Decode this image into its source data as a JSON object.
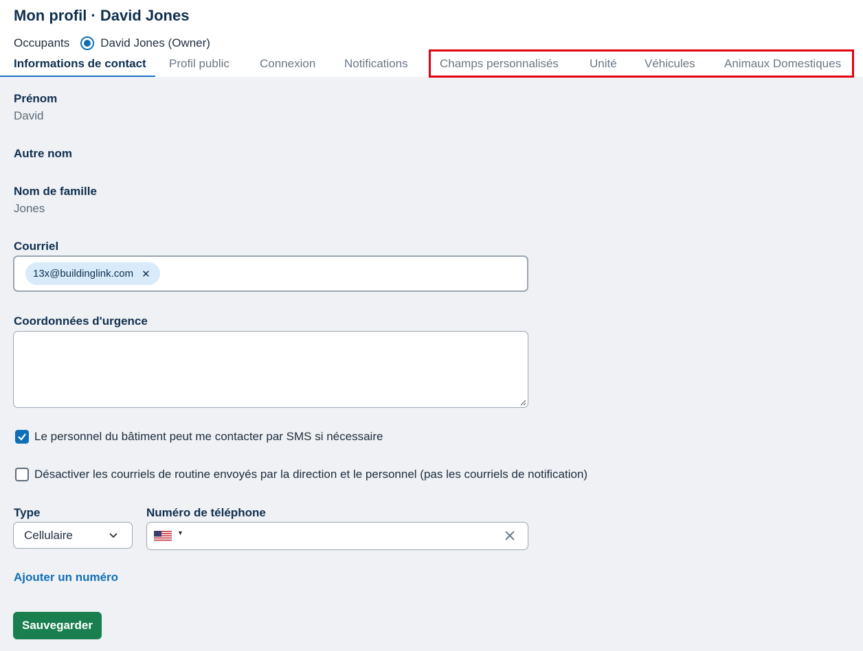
{
  "header": {
    "title": "Mon profil · David Jones",
    "occupants_label": "Occupants",
    "occupant_selected": "David Jones (Owner)"
  },
  "tabs": [
    {
      "label": "Informations de contact",
      "active": true
    },
    {
      "label": "Profil public",
      "active": false
    },
    {
      "label": "Connexion",
      "active": false
    },
    {
      "label": "Notifications",
      "active": false
    },
    {
      "label": "Champs personnalisés",
      "active": false
    },
    {
      "label": "Unité",
      "active": false
    },
    {
      "label": "Véhicules",
      "active": false
    },
    {
      "label": "Animaux Domestiques",
      "active": false
    }
  ],
  "form": {
    "first_name": {
      "label": "Prénom",
      "value": "David"
    },
    "other_name": {
      "label": "Autre nom",
      "value": ""
    },
    "last_name": {
      "label": "Nom de famille",
      "value": "Jones"
    },
    "email": {
      "label": "Courriel",
      "chips": [
        "13x@buildinglink.com"
      ]
    },
    "emergency": {
      "label": "Coordonnées d'urgence",
      "value": ""
    },
    "sms_checkbox": {
      "label": "Le personnel du bâtiment peut me contacter par SMS si nécessaire",
      "checked": true
    },
    "routine_email_checkbox": {
      "label": "Désactiver les courriels de routine envoyés par la direction et le personnel (pas les courriels de notification)",
      "checked": false
    },
    "phone_type": {
      "label": "Type",
      "value": "Cellulaire"
    },
    "phone_number": {
      "label": "Numéro de téléphone",
      "value": "",
      "country": "us-flag-icon"
    },
    "add_number_link": "Ajouter un numéro",
    "save_button": "Sauvegarder"
  },
  "colors": {
    "accent": "#0f6fb6",
    "save": "#1a7f4e",
    "highlight": "#e3000f",
    "title": "#0f2f4f"
  }
}
